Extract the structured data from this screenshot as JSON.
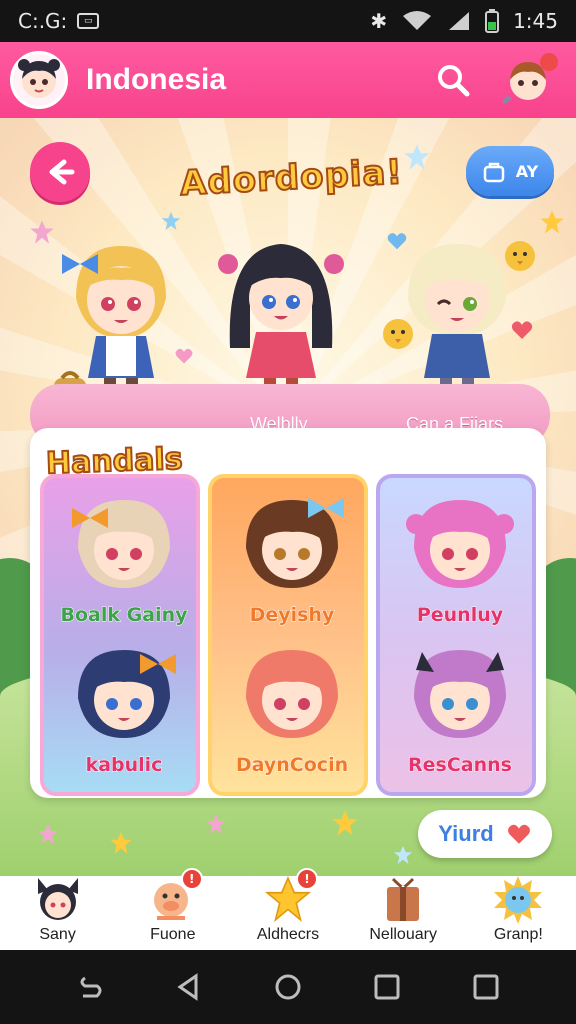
{
  "status_bar": {
    "left_text": "C:.G:",
    "time": "1:45"
  },
  "header": {
    "title": "Indonesia"
  },
  "hero": {
    "logo_text": "Adordopia!",
    "ay_button_label": "AY"
  },
  "banner": {
    "left_label": "Welblly",
    "right_label": "Can a Fiiars"
  },
  "section": {
    "title": "Handals",
    "cards": [
      {
        "top": "Boalk Gainy",
        "bottom": "kabulic",
        "top_color": "#3ea14b",
        "bottom_color": "#e5336b"
      },
      {
        "top": "Deyishy",
        "bottom": "DaynCocin",
        "top_color": "#f07a2b",
        "bottom_color": "#f07a2b"
      },
      {
        "top": "Peunluy",
        "bottom": "ResCanns",
        "top_color": "#e5336b",
        "bottom_color": "#e5336b"
      }
    ]
  },
  "yurd_button": {
    "label": "Yiurd"
  },
  "tabs": [
    {
      "label": "Sany",
      "icon": "cat-girl-icon",
      "badge": false
    },
    {
      "label": "Fuone",
      "icon": "pig-icon",
      "badge": true
    },
    {
      "label": "Aldhecrs",
      "icon": "star-icon",
      "badge": true
    },
    {
      "label": "Nellouary",
      "icon": "gift-icon",
      "badge": false
    },
    {
      "label": "Granp!",
      "icon": "sun-icon",
      "badge": false
    }
  ],
  "colors": {
    "brand_pink": "#f7438c",
    "blue": "#3c86eb",
    "yellow": "#ffcb3d"
  }
}
